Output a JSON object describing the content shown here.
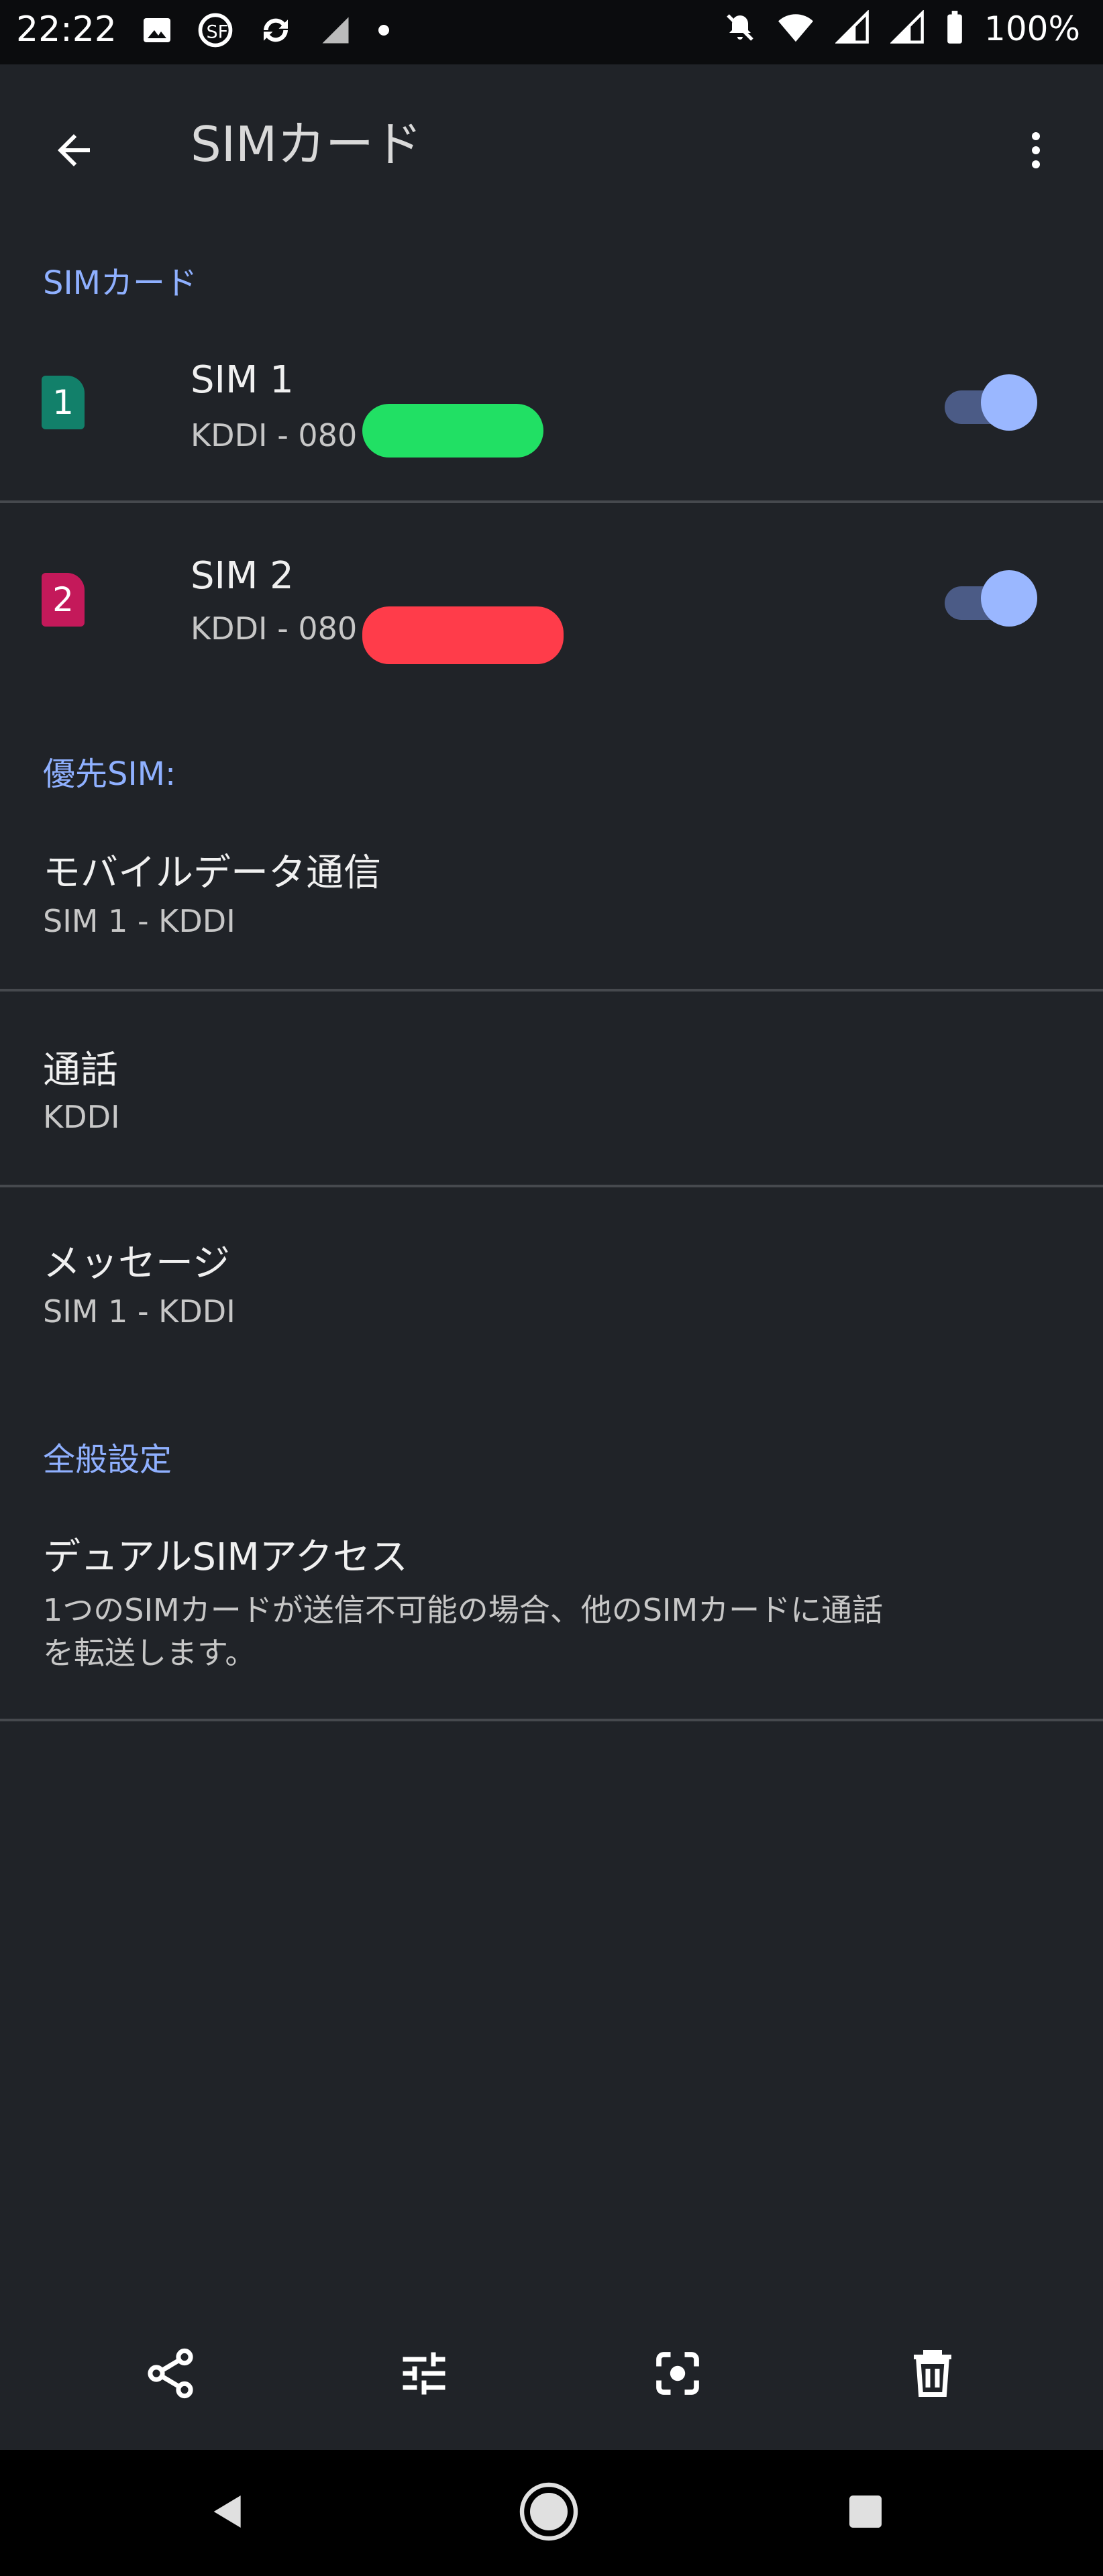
{
  "status_bar": {
    "time": "22:22",
    "battery": "100%",
    "icons_left": [
      "image-icon",
      "notification-app-icon",
      "sync-icon",
      "navigation-icon",
      "dot-icon"
    ],
    "icons_right": [
      "bell-off-icon",
      "wifi-icon",
      "signal-icon",
      "signal-icon",
      "battery-icon"
    ]
  },
  "appbar": {
    "title": "SIMカード",
    "back_icon": "back-arrow-icon",
    "menu_icon": "more-vert-icon"
  },
  "sim_section": {
    "header": "SIMカード",
    "sims": [
      {
        "badge": "1",
        "title": "SIM 1",
        "subtitle": "KDDI - 080",
        "enabled": true,
        "badge_color": "#12806a",
        "redaction_color": "#21e064"
      },
      {
        "badge": "2",
        "title": "SIM 2",
        "subtitle": "KDDI - 080",
        "enabled": true,
        "badge_color": "#c4195a",
        "redaction_color": "#ff3c4a"
      }
    ]
  },
  "preferred_section": {
    "header": "優先SIM:",
    "items": [
      {
        "title": "モバイルデータ通信",
        "subtitle": "SIM 1 - KDDI"
      },
      {
        "title": "通話",
        "subtitle": "KDDI"
      },
      {
        "title": "メッセージ",
        "subtitle": "SIM 1 - KDDI"
      }
    ]
  },
  "general_section": {
    "header": "全般設定",
    "items": [
      {
        "title": "デュアルSIMアクセス",
        "subtitle_line1": "1つのSIMカードが送信不可能の場合、他のSIMカードに通話",
        "subtitle_line2": "を転送します。"
      }
    ]
  },
  "bottom_toolbar": [
    "share-icon",
    "tune-icon",
    "lens-icon",
    "delete-icon"
  ],
  "navigation_bar": [
    "back-icon",
    "home-icon",
    "recents-icon"
  ],
  "colors": {
    "background": "#202328",
    "accent": "#8fb0ff",
    "toggle_track": "#4b5b86",
    "toggle_thumb": "#9ab7ff"
  }
}
